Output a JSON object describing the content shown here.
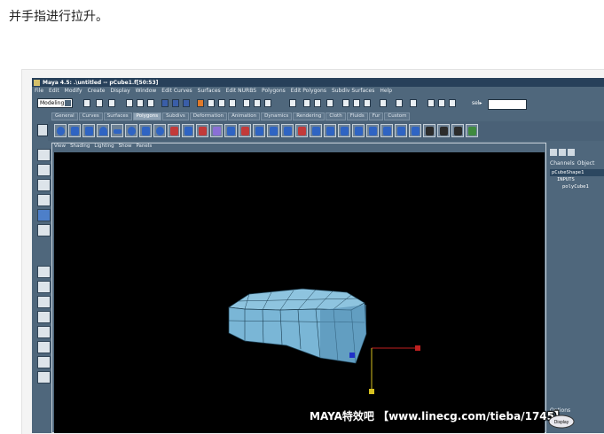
{
  "caption": "并手指进行拉升。",
  "window": {
    "title": "Maya 4.5: .\\untitled  --  pCube1.f[50:53]"
  },
  "menubar": {
    "items": [
      "File",
      "Edit",
      "Modify",
      "Create",
      "Display",
      "Window",
      "Edit Curves",
      "Surfaces",
      "Edit NURBS",
      "Polygons",
      "Edit Polygons",
      "Subdiv Surfaces",
      "Help"
    ]
  },
  "statusline": {
    "mode": "Modeling",
    "search_label": "sel▸"
  },
  "shelf": {
    "tabs": [
      "General",
      "Curves",
      "Surfaces",
      "Polygons",
      "Subdivs",
      "Deformation",
      "Animation",
      "Dynamics",
      "Rendering",
      "Cloth",
      "Fluids",
      "Fur",
      "Custom"
    ],
    "active_tab": "Polygons"
  },
  "panel_menu": {
    "items": [
      "View",
      "Shading",
      "Lighting",
      "Show",
      "Panels"
    ]
  },
  "channel_box": {
    "tabs": [
      "Channels",
      "Object"
    ],
    "rows": [
      "pCubeShape1",
      "INPUTS",
      "polyCube1"
    ],
    "footer": "Options"
  },
  "watermark": {
    "text": "MAYA特效吧 【www.linecg.com/tieba/1745】",
    "badge": "Display"
  },
  "colors": {
    "maya_bg": "#4f677c",
    "title_bar": "#27405a",
    "viewport": "#000000",
    "mesh": "#8ec4df",
    "manip_x": "#c02020",
    "manip_y": "#d6c020",
    "manip_z": "#2030c8"
  },
  "icons": {
    "toolbox": [
      "select-tool-icon",
      "lasso-tool-icon",
      "paint-select-icon",
      "move-tool-icon",
      "rotate-tool-icon",
      "scale-tool-icon",
      "show-manip-icon"
    ],
    "layout": [
      "single-view-icon",
      "four-view-icon",
      "side-by-side-icon",
      "stacked-view-icon",
      "persp-outliner-icon",
      "persp-graph-icon",
      "hypershade-icon",
      "script-editor-icon"
    ]
  }
}
